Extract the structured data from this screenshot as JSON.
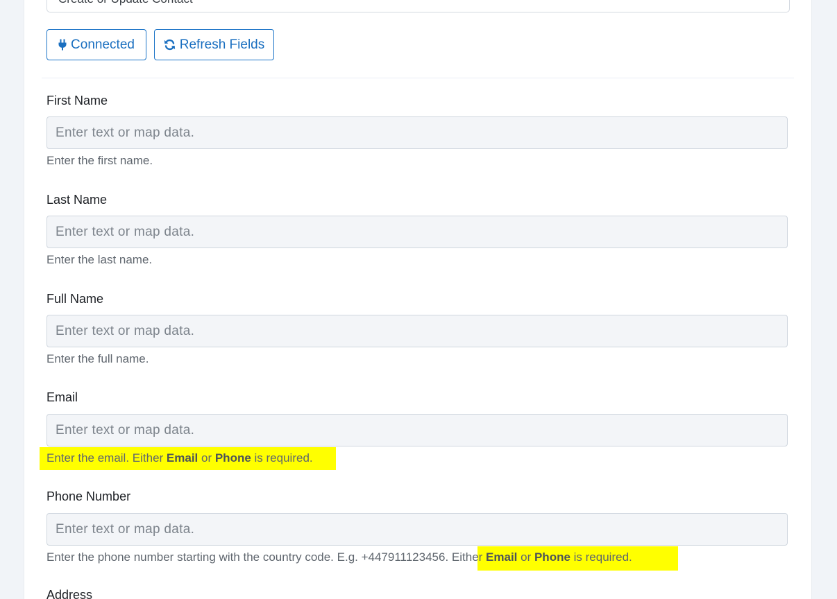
{
  "top_select": {
    "value": "Create or Update Contact"
  },
  "buttons": {
    "connected": "Connected",
    "refresh": "Refresh Fields"
  },
  "colors": {
    "accent": "#1a73c7",
    "highlight": "#ffff00",
    "page_background": "#f1f4f8"
  },
  "fields": {
    "first_name": {
      "label": "First Name",
      "placeholder": "Enter text or map data.",
      "help": "Enter the first name."
    },
    "last_name": {
      "label": "Last Name",
      "placeholder": "Enter text or map data.",
      "help": "Enter the last name."
    },
    "full_name": {
      "label": "Full Name",
      "placeholder": "Enter text or map data.",
      "help": "Enter the full name."
    },
    "email": {
      "label": "Email",
      "placeholder": "Enter text or map data.",
      "help_prefix": "Enter the email. Either ",
      "help_bold_1": "Email",
      "help_mid": " or ",
      "help_bold_2": "Phone",
      "help_suffix": " is required."
    },
    "phone": {
      "label": "Phone Number",
      "placeholder": "Enter text or map data.",
      "help_prefix": "Enter the phone number starting with the country code. E.g. +447911123456.",
      "help_either": " Either ",
      "help_bold_1": "Email",
      "help_mid": " or ",
      "help_bold_2": "Phone",
      "help_suffix": " is required."
    },
    "address": {
      "label": "Address"
    }
  },
  "icons": {
    "connected": "plug-icon",
    "refresh": "refresh-icon"
  }
}
